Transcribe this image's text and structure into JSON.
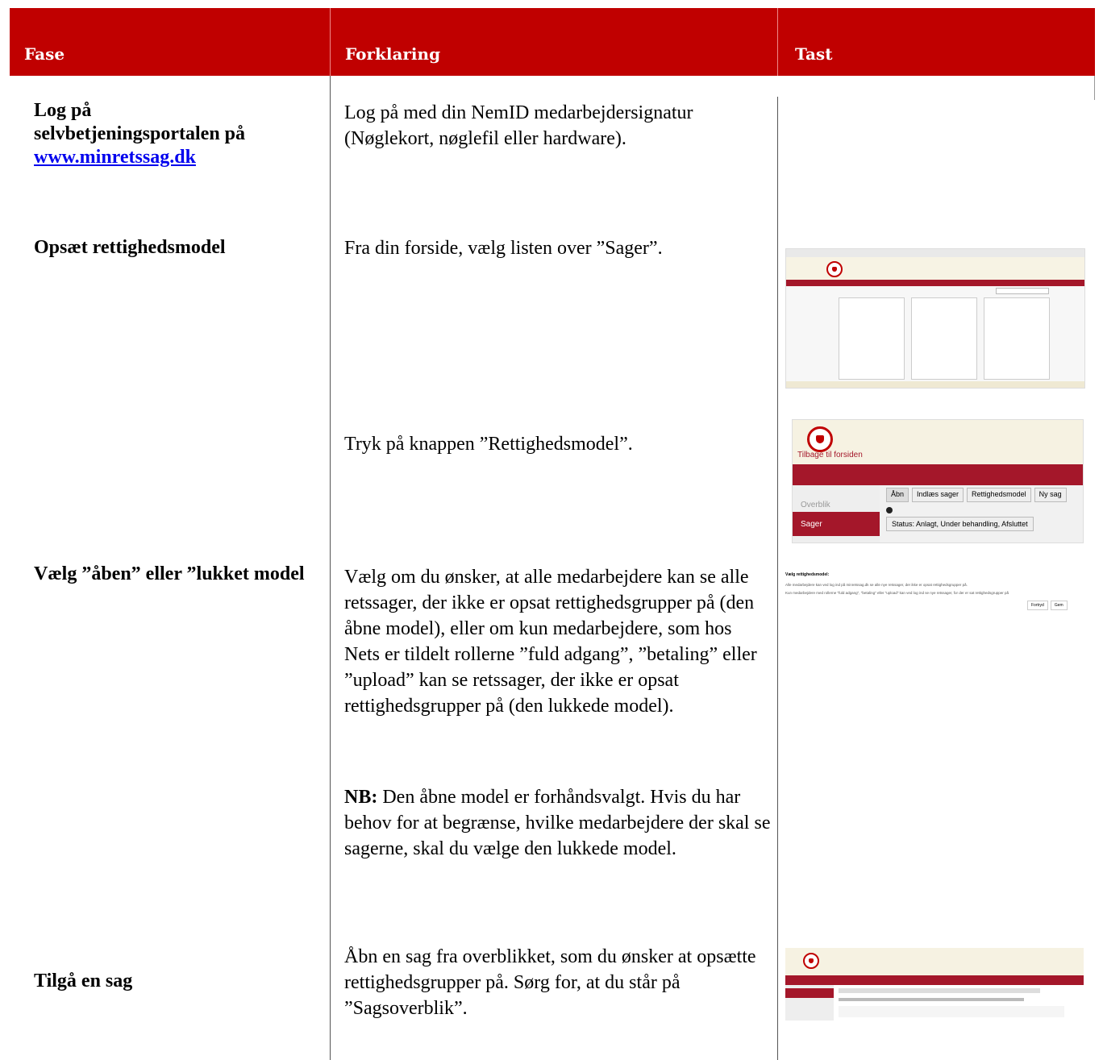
{
  "header": {
    "fase": "Fase",
    "forklaring": "Forklaring",
    "tast": "Tast"
  },
  "rows": [
    {
      "fase_line1": "Log på",
      "fase_line2": "selvbetjeningsportalen på",
      "fase_link": "www.minretssag.dk",
      "expl": "Log på med din NemID medarbejdersignatur (Nøglekort, nøglefil eller hardware)."
    },
    {
      "fase": "Opsæt rettighedsmodel",
      "expl": "Fra din forside, vælg listen over ”Sager”.",
      "expl2": "Tryk på knappen ”Rettighedsmodel”."
    },
    {
      "fase": "Vælg ”åben” eller ”lukket model",
      "expl": "Vælg om du ønsker, at alle medarbejdere kan se alle retssager, der ikke er opsat rettighedsgrupper på (den åbne model), eller om kun medarbejdere, som hos Nets er tildelt rollerne ”fuld adgang”, ”betaling” eller ”upload” kan se retssager, der ikke er opsat rettighedsgrupper på (den lukkede model).",
      "nb_label": "NB:",
      "nb_text": " Den åbne model er forhåndsvalgt. Hvis du har behov for at begrænse, hvilke medarbejdere der skal se sagerne, skal du vælge den lukkede model."
    },
    {
      "fase": "Tilgå en sag",
      "expl": "Åbn en sag fra overblikket, som du ønsker at opsætte rettighedsgrupper på. Sørg for, at du står på ”Sagsoverblik”."
    }
  ],
  "thumb_rettighed": {
    "back_link": "Tilbage til forsiden",
    "nav_overblik": "Overblik",
    "nav_sager": "Sager",
    "btn_abn": "Åbn",
    "btn_indlaes": "Indlæs sager",
    "btn_rettighed": "Rettighedsmodel",
    "btn_nysag": "Ny sag",
    "status": "Status: Anlagt, Under behandling, Afsluttet"
  },
  "thumb_model": {
    "title": "Vælg rettighedsmodel:",
    "opt1": "Alle medarbejdere kan ved log ind på minretssag.dk se alle nye retssager, der ikke er opsat rettighedsgrupper på.",
    "opt2": "Kun medarbejdere med rollerne \"fuld adgang\", \"betaling\" eller \"upload\" kan ved log ind se nye retssager, for der er sat rettighedsgrupper på",
    "btn_fortryd": "Fortryd",
    "btn_gem": "Gem"
  },
  "colors": {
    "header_red": "#c00000",
    "nav_red": "#a4172a"
  }
}
